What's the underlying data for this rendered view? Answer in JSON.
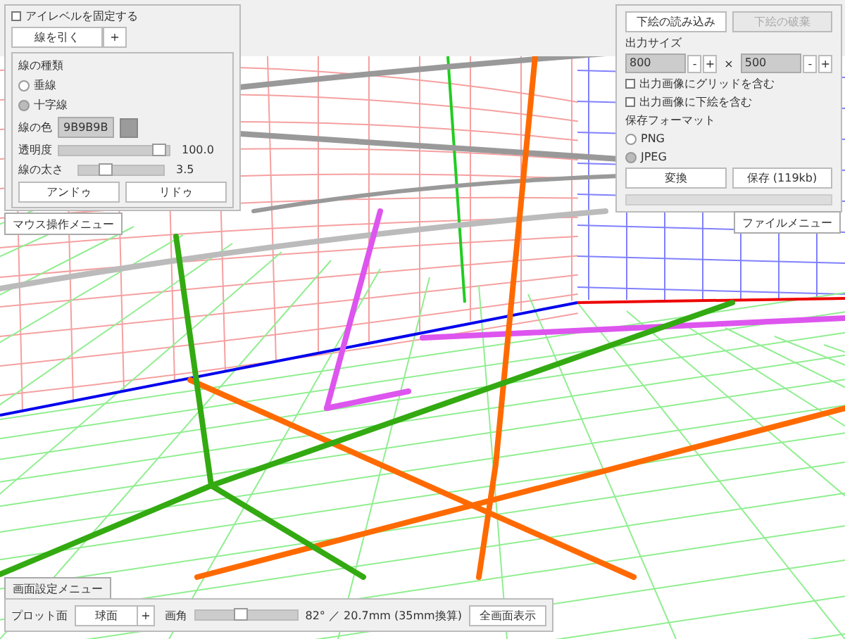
{
  "eye_level": {
    "label": "アイレベルを固定する",
    "checked": false
  },
  "line_tool": {
    "button": "線を引く",
    "plus": "+"
  },
  "line_panel": {
    "heading": "線の種類",
    "types": [
      {
        "label": "垂線",
        "selected": false
      },
      {
        "label": "十字線",
        "selected": true
      }
    ],
    "color_label": "線の色",
    "color_value": "9B9B9B",
    "sliders": [
      {
        "label": "透明度",
        "level": 1.0,
        "reading": "100.0"
      },
      {
        "label": "線の太さ",
        "level": 0.3,
        "reading": "3.5"
      }
    ],
    "buttons": [
      "アンドゥ",
      "リドゥ"
    ]
  },
  "mouse_menu": {
    "label": "マウス操作メニュー"
  },
  "file_panel": {
    "buttons": [
      {
        "label": "下絵の読み込み",
        "disabled": false
      },
      {
        "label": "下絵の破棄",
        "disabled": true
      }
    ],
    "size_label": "出力サイズ",
    "width": {
      "value": "800",
      "minus": "-",
      "plus": "+"
    },
    "times": "×",
    "height": {
      "value": "500",
      "minus": "-",
      "plus": "+"
    },
    "options": [
      {
        "label": "出力画像にグリッドを含む",
        "checked": false
      },
      {
        "label": "出力画像に下絵を含む",
        "checked": false
      }
    ],
    "format_label": "保存フォーマット",
    "formats": [
      {
        "label": "PNG",
        "selected": false
      },
      {
        "label": "JPEG",
        "selected": true
      }
    ],
    "actions": [
      "変換",
      "保存 (119kb)"
    ],
    "progress": {
      "level": 0
    }
  },
  "file_menu": {
    "label": "ファイルメニュー"
  },
  "screen_menu": {
    "tab": "画面設定メニュー",
    "plot_label": "プロット面",
    "plot_value": "球面",
    "plot_plus": "+",
    "angle_label": "画角",
    "angle": {
      "level": 0.45
    },
    "angle_reading": "82° ／ 20.7mm (35mm換算)",
    "fullscreen": "全画面表示"
  }
}
